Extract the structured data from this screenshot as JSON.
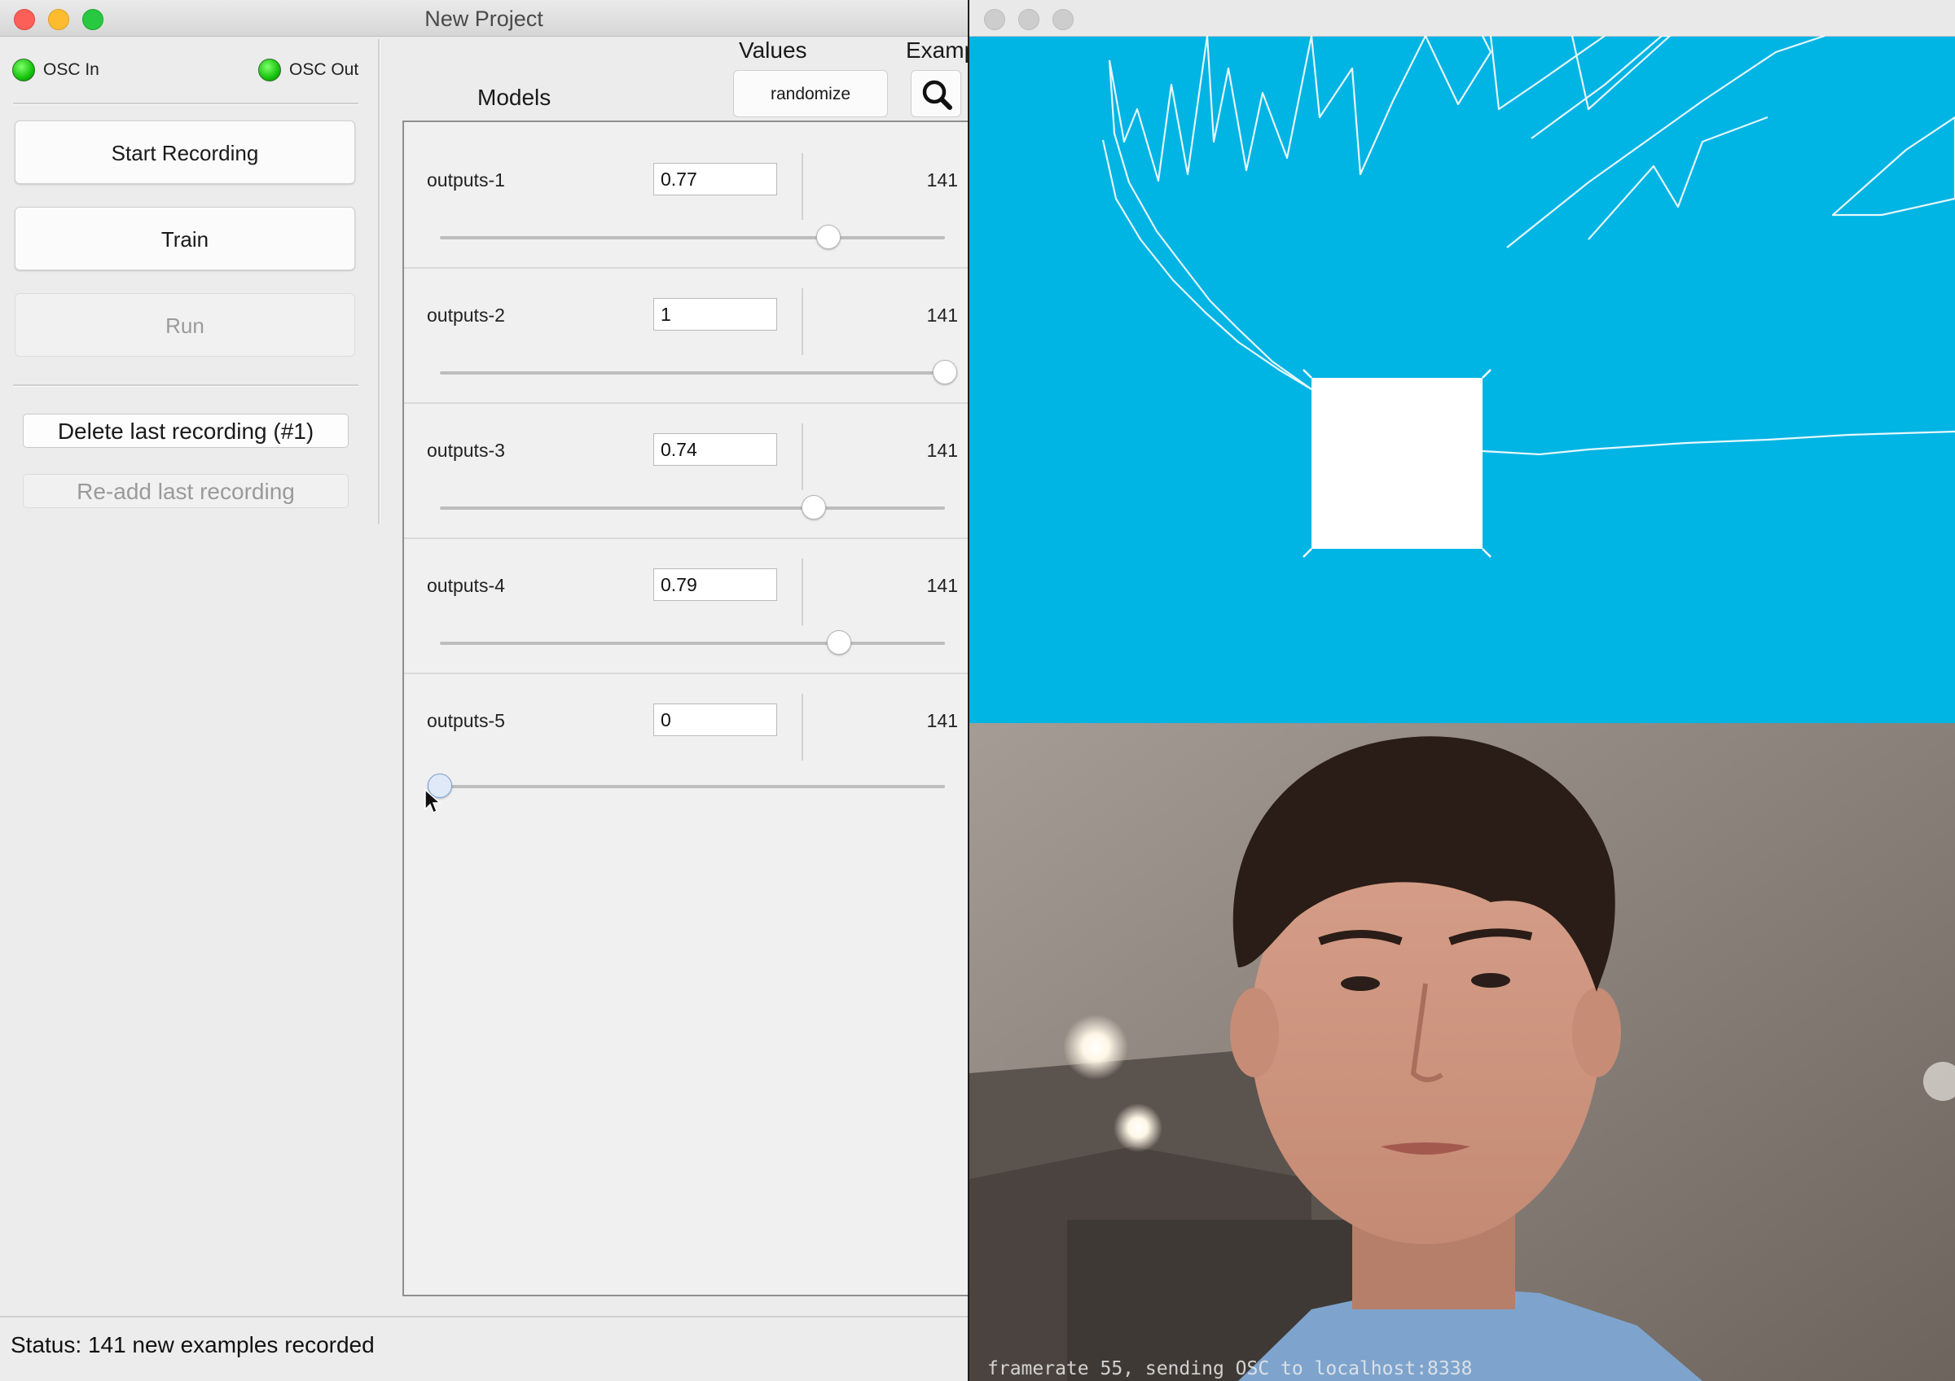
{
  "window": {
    "title": "New Project"
  },
  "osc": {
    "in_label": "OSC In",
    "out_label": "OSC Out"
  },
  "buttons": {
    "start_recording": "Start Recording",
    "train": "Train",
    "run": "Run",
    "delete_last": "Delete last recording (#1)",
    "readd_last": "Re-add last recording",
    "randomize": "randomize"
  },
  "headers": {
    "models": "Models",
    "values": "Values",
    "examples": "Examp"
  },
  "outputs": [
    {
      "name": "outputs-1",
      "value": "0.77",
      "count": "141",
      "slider": 0.77
    },
    {
      "name": "outputs-2",
      "value": "1",
      "count": "141",
      "slider": 1.0
    },
    {
      "name": "outputs-3",
      "value": "0.74",
      "count": "141",
      "slider": 0.74
    },
    {
      "name": "outputs-4",
      "value": "0.79",
      "count": "141",
      "slider": 0.79
    },
    {
      "name": "outputs-5",
      "value": "0",
      "count": "141",
      "slider": 0.0
    }
  ],
  "status": {
    "text": "Status:  141 new examples recorded"
  },
  "camera": {
    "overlay": "framerate 55, sending OSC to localhost:8338"
  },
  "colors": {
    "sketch_bg": "#00b4e4",
    "led_green": "#17c20d"
  },
  "icons": [
    "search-icon",
    "close-icon",
    "minimize-icon",
    "zoom-icon"
  ]
}
